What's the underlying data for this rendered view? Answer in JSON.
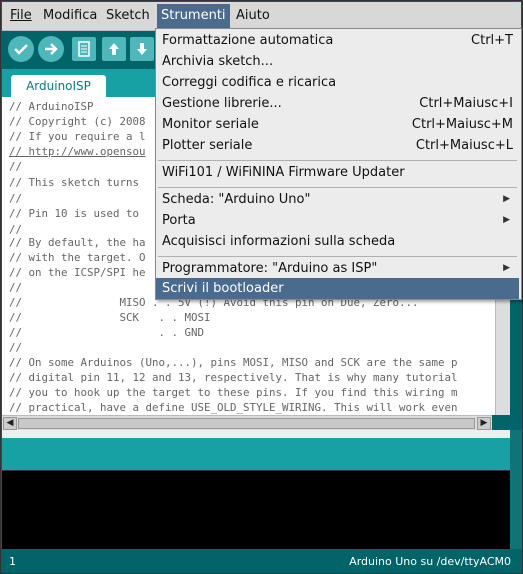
{
  "menubar": {
    "items": [
      "File",
      "Modifica",
      "Sketch",
      "Strumenti",
      "Aiuto"
    ]
  },
  "tab": {
    "label": "ArduinoISP"
  },
  "editor": {
    "lines": [
      "// ArduinoISP",
      "// Copyright (c) 2008",
      "// If you require a l",
      "// http://www.opensou",
      "//",
      "// This sketch turns",
      "//",
      "// Pin 10 is used to",
      "//",
      "// By default, the ha",
      "// with the target. O",
      "// on the ICSP/SPI he",
      "//",
      "//               MISO . . 5V (!) Avoid this pin on Due, Zero...",
      "//               SCK   . . MOSI",
      "//                     . . GND",
      "//",
      "// On some Arduinos (Uno,...), pins MOSI, MISO and SCK are the same p",
      "// digital pin 11, 12 and 13, respectively. That is why many tutorial",
      "// you to hook up the target to these pins. If you find this wiring m",
      "// practical, have a define USE_OLD_STYLE_WIRING. This will work even"
    ]
  },
  "dropdown": {
    "items": [
      {
        "label": "Formattazione automatica",
        "shortcut": "Ctrl+T"
      },
      {
        "label": "Archivia sketch...",
        "shortcut": ""
      },
      {
        "label": "Correggi codifica e ricarica",
        "shortcut": ""
      },
      {
        "label": "Gestione librerie...",
        "shortcut": "Ctrl+Maiusc+I"
      },
      {
        "label": "Monitor seriale",
        "shortcut": "Ctrl+Maiusc+M"
      },
      {
        "label": "Plotter seriale",
        "shortcut": "Ctrl+Maiusc+L"
      },
      {
        "label": "WiFi101 / WiFiNINA Firmware Updater",
        "shortcut": ""
      },
      {
        "label": "Scheda: \"Arduino Uno\"",
        "shortcut": ""
      },
      {
        "label": "Porta",
        "shortcut": ""
      },
      {
        "label": "Acquisisci informazioni sulla scheda",
        "shortcut": ""
      },
      {
        "label": "Programmatore: \"Arduino as ISP\"",
        "shortcut": ""
      },
      {
        "label": "Scrivi il bootloader",
        "shortcut": ""
      }
    ]
  },
  "status": {
    "line": "1",
    "board": "Arduino Uno su /dev/ttyACM0"
  },
  "colors": {
    "teal_dark": "#006468",
    "teal_light": "#17a1a5",
    "menu_highlight": "#4a6a8e"
  }
}
